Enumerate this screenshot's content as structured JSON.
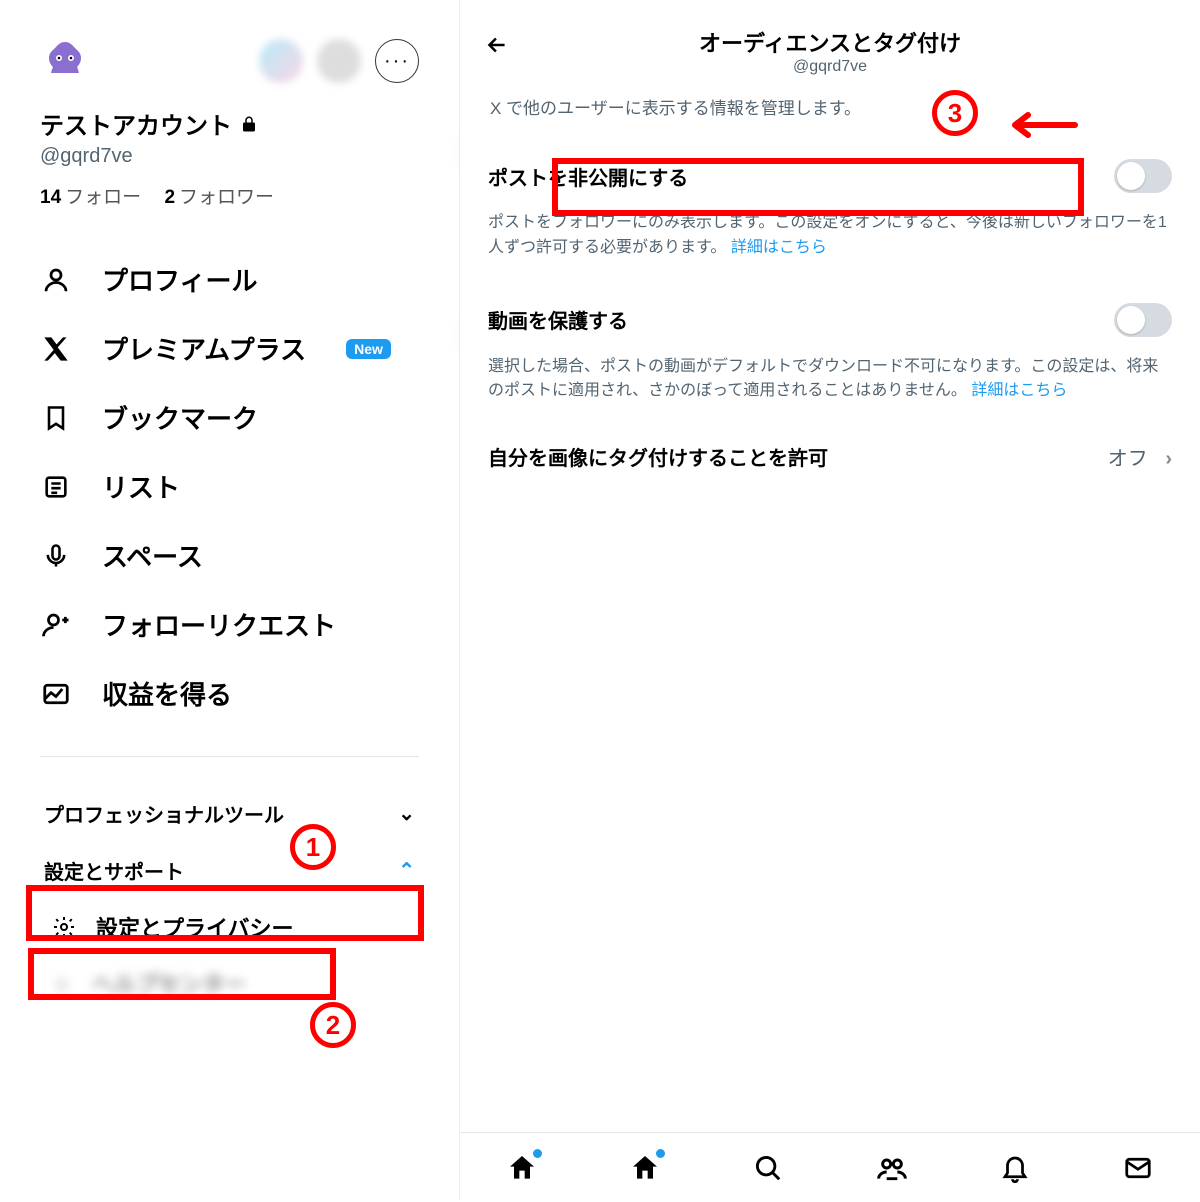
{
  "left": {
    "displayName": "テストアカウント",
    "handle": "@gqrd7ve",
    "followingCount": "14",
    "followingLabel": "フォロー",
    "followerCount": "2",
    "followerLabel": "フォロワー",
    "nav": {
      "profile": "プロフィール",
      "premium": "プレミアムプラス",
      "newBadge": "New",
      "bookmarks": "ブックマーク",
      "lists": "リスト",
      "spaces": "スペース",
      "followRequests": "フォローリクエスト",
      "monetize": "収益を得る"
    },
    "proTools": "プロフェッショナルツール",
    "settingsSupport": "設定とサポート",
    "settingsPrivacy": "設定とプライバシー",
    "helpCenter": "ヘルプセンター"
  },
  "right": {
    "title": "オーディエンスとタグ付け",
    "handle": "@gqrd7ve",
    "desc": "X で他のユーザーに表示する情報を管理します。",
    "s1": {
      "title": "ポストを非公開にする",
      "sub": "ポストをフォロワーにのみ表示します。この設定をオンにすると、今後は新しいフォロワーを1人ずつ許可する必要があります。",
      "link": "詳細はこちら"
    },
    "s2": {
      "title": "動画を保護する",
      "sub": "選択した場合、ポストの動画がデフォルトでダウンロード不可になります。この設定は、将来のポストに適用され、さかのぼって適用されることはありません。",
      "link": "詳細はこちら"
    },
    "s3": {
      "title": "自分を画像にタグ付けすることを許可",
      "val": "オフ"
    }
  },
  "ann": {
    "n1": "1",
    "n2": "2",
    "n3": "3"
  }
}
